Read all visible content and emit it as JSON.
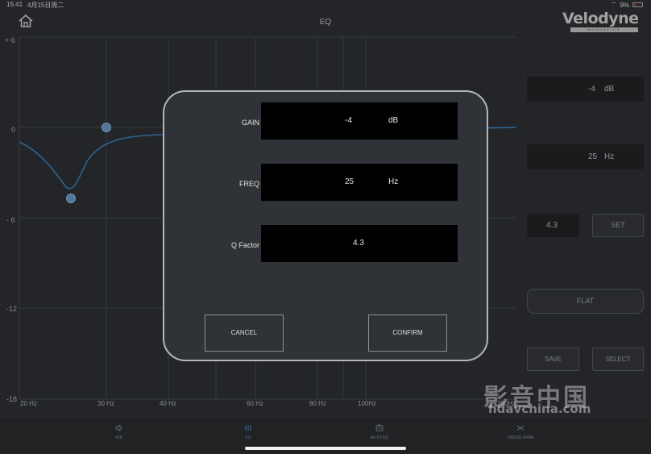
{
  "status_bar": {
    "time": "15:41",
    "date": "4月15日周二",
    "battery_text": "9%"
  },
  "header": {
    "title": "EQ",
    "brand": "Velodyne",
    "brand_sub": "ACOUSTICS"
  },
  "graph": {
    "y_labels": [
      "+ 6",
      "0",
      "- 6",
      "-12",
      "-18"
    ],
    "x_labels": [
      "20 Hz",
      "30 Hz",
      "40 Hz",
      "60 Hz",
      "80 Hz",
      "100Hz",
      "200Hz"
    ]
  },
  "right_panel": {
    "gain_value": "-4",
    "gain_unit": "dB",
    "freq_value": "25",
    "freq_unit": "Hz",
    "q_value": "4.3",
    "set_label": "SET",
    "flat_label": "FLAT",
    "save_label": "SAVE",
    "select_label": "SELECT"
  },
  "tabs": [
    {
      "label": "VOL",
      "icon": "speaker-icon"
    },
    {
      "label": "EQ",
      "icon": "eq-icon"
    },
    {
      "label": "AUTO EQ",
      "icon": "auto-eq-icon"
    },
    {
      "label": "CROSS OVER",
      "icon": "crossover-icon"
    }
  ],
  "dialog": {
    "gain_label": "GAIN",
    "gain_value": "-4",
    "gain_unit": "dB",
    "freq_label": "FREQ",
    "freq_value": "25",
    "freq_unit": "Hz",
    "q_label": "Q Factor",
    "q_value": "4.3",
    "cancel_label": "CANCEL",
    "confirm_label": "CONFIRM"
  },
  "watermark": {
    "line1": "影音中国",
    "line2": "hdavchina.com"
  },
  "colors": {
    "accent": "#5b8fc7",
    "curve": "#3f86c4",
    "background": "#2f3236"
  }
}
